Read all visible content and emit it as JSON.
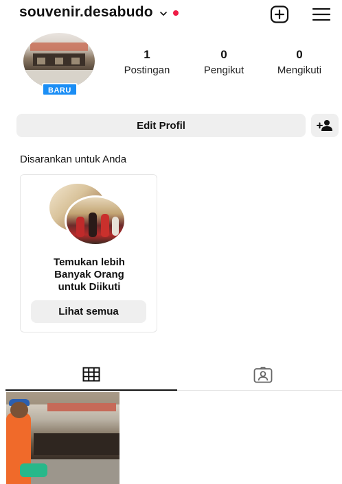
{
  "header": {
    "username": "souvenir.desabudo",
    "icons": {
      "switch": "chevron-down-icon",
      "new_post": "plus-square-icon",
      "menu": "hamburger-menu-icon"
    },
    "notification_color": "#ee1c46"
  },
  "profile": {
    "badge": "BARU",
    "badge_color": "#1b8ef5",
    "stats": [
      {
        "value": "1",
        "label": "Postingan"
      },
      {
        "value": "0",
        "label": "Pengikut"
      },
      {
        "value": "0",
        "label": "Mengikuti"
      }
    ]
  },
  "actions": {
    "edit_profile": "Edit Profil",
    "add_user_icon": "add-person-icon"
  },
  "suggestions": {
    "title": "Disarankan untuk Anda",
    "card_text_lines": [
      "Temukan lebih",
      "Banyak Orang",
      "untuk Diikuti"
    ],
    "card_button": "Lihat semua"
  },
  "tabs": [
    {
      "icon": "grid-icon",
      "active": true
    },
    {
      "icon": "tagged-person-icon",
      "active": false
    }
  ],
  "posts": [
    {
      "thumbnail": "post-thumbnail"
    }
  ]
}
